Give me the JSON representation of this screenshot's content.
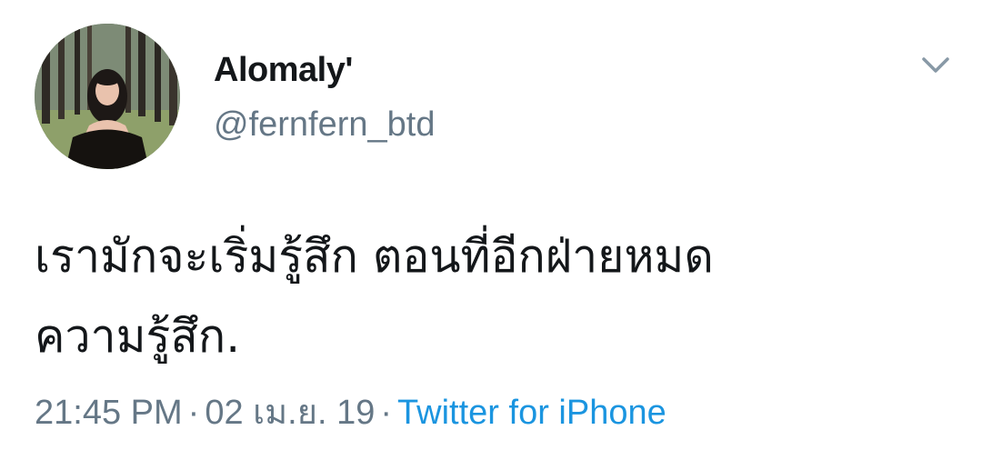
{
  "author": {
    "display_name": "Alomaly'",
    "handle": "@fernfern_btd"
  },
  "tweet": {
    "line1": "เรามักจะเริ่มรู้สึก ตอนที่อีกฝ่ายหมด",
    "line2": "ความรู้สึก."
  },
  "meta": {
    "time": "21:45 PM",
    "separator": "·",
    "date": "02 เม.ย. 19",
    "source": "Twitter for iPhone"
  },
  "icons": {
    "menu": "chevron-down-icon"
  },
  "colors": {
    "text": "#14171a",
    "secondary": "#657786",
    "link": "#1b95e0"
  }
}
